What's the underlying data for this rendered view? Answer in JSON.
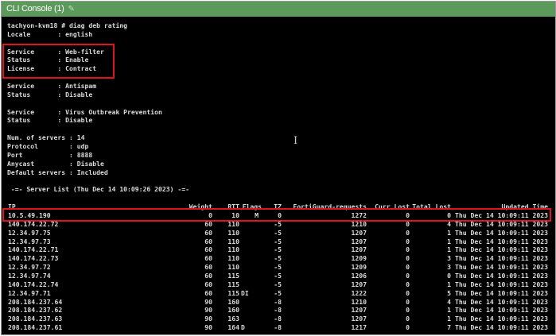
{
  "window": {
    "title": "CLI Console (1)",
    "edit_icon": "pencil-icon"
  },
  "header_lines": [
    "tachyon-kvm18 # diag deb rating",
    "Locale       : english",
    "",
    "Service      : Web-filter",
    "Status       : Enable",
    "License      : Contract",
    "",
    "Service      : Antispam",
    "Status       : Disable",
    "",
    "Service      : Virus Outbreak Prevention",
    "Status       : Disable",
    "",
    "Num. of servers : 14",
    "Protocol        : udp",
    "Port            : 8888",
    "Anycast         : Disable",
    "Default servers : Included",
    "",
    " -=- Server List (Thu Dec 14 10:09:26 2023) -=-"
  ],
  "table": {
    "headers": [
      "IP",
      "Weight",
      "RTT",
      "Flags",
      "TZ",
      "FortiGuard-requests",
      "Curr Lost",
      "Total Lost",
      "Updated Time"
    ],
    "rows": [
      [
        "10.5.49.190",
        "0",
        "10",
        "M",
        "0",
        "1272",
        "0",
        "0",
        "Thu Dec 14 10:09:11 2023"
      ],
      [
        "140.174.22.72",
        "60",
        "110",
        "",
        "-5",
        "1210",
        "0",
        "4",
        "Thu Dec 14 10:09:11 2023"
      ],
      [
        "12.34.97.75",
        "60",
        "110",
        "",
        "-5",
        "1207",
        "0",
        "1",
        "Thu Dec 14 10:09:11 2023"
      ],
      [
        "12.34.97.73",
        "60",
        "110",
        "",
        "-5",
        "1207",
        "0",
        "1",
        "Thu Dec 14 10:09:11 2023"
      ],
      [
        "140.174.22.71",
        "60",
        "110",
        "",
        "-5",
        "1207",
        "0",
        "1",
        "Thu Dec 14 10:09:11 2023"
      ],
      [
        "140.174.22.73",
        "60",
        "110",
        "",
        "-5",
        "1209",
        "0",
        "3",
        "Thu Dec 14 10:09:11 2023"
      ],
      [
        "12.34.97.72",
        "60",
        "110",
        "",
        "-5",
        "1209",
        "0",
        "3",
        "Thu Dec 14 10:09:11 2023"
      ],
      [
        "12.34.97.74",
        "60",
        "115",
        "",
        "-5",
        "1206",
        "0",
        "0",
        "Thu Dec 14 10:09:11 2023"
      ],
      [
        "140.174.22.74",
        "60",
        "115",
        "",
        "-5",
        "1207",
        "0",
        "1",
        "Thu Dec 14 10:09:11 2023"
      ],
      [
        "12.34.97.71",
        "60",
        "115",
        "DI",
        "-5",
        "1222",
        "0",
        "5",
        "Thu Dec 14 10:09:11 2023"
      ],
      [
        "208.184.237.64",
        "90",
        "160",
        "",
        "-8",
        "1210",
        "0",
        "4",
        "Thu Dec 14 10:09:11 2023"
      ],
      [
        "208.184.237.62",
        "90",
        "160",
        "",
        "-8",
        "1207",
        "0",
        "1",
        "Thu Dec 14 10:09:11 2023"
      ],
      [
        "208.184.237.63",
        "90",
        "163",
        "",
        "-8",
        "1207",
        "0",
        "1",
        "Thu Dec 14 10:09:11 2023"
      ],
      [
        "208.184.237.61",
        "90",
        "164",
        "D",
        "-8",
        "1217",
        "0",
        "7",
        "Thu Dec 14 10:09:11 2023"
      ]
    ]
  },
  "colors": {
    "titlebar": "#5b9a5b",
    "highlight": "#e0141e",
    "terminal_bg": "#000000"
  }
}
